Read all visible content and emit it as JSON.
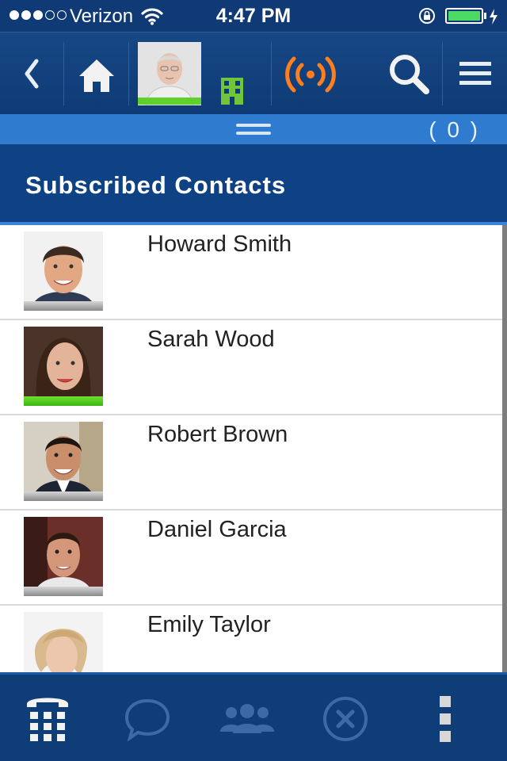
{
  "status_bar": {
    "carrier": "Verizon",
    "time": "4:47 PM",
    "signal_bars_filled": 3,
    "signal_bars_total": 5,
    "battery_level": 0.9,
    "battery_color": "#4cd964"
  },
  "toolbar": {
    "icons": [
      "back-icon",
      "home-icon",
      "avatar",
      "building-icon",
      "broadcast-icon",
      "search-icon",
      "menu-icon"
    ],
    "presence_color": "#5ed12a",
    "broadcast_color": "#ff7f1e"
  },
  "strip": {
    "count": "( 0 )"
  },
  "header": {
    "title": "Subscribed Contacts"
  },
  "contacts": [
    {
      "name": "Howard Smith",
      "status": "offline"
    },
    {
      "name": "Sarah Wood",
      "status": "online"
    },
    {
      "name": "Robert Brown",
      "status": "offline"
    },
    {
      "name": "Daniel Garcia",
      "status": "offline"
    },
    {
      "name": "Emily Taylor",
      "status": "offline"
    }
  ],
  "bottom_bar": {
    "icons": [
      "dialpad-icon",
      "chat-icon",
      "contacts-icon",
      "cancel-icon",
      "more-icon"
    ]
  },
  "colors": {
    "navy": "#0f3a75",
    "strip_blue": "#2f7bcf",
    "header_blue": "#0e4285",
    "online": "#5ed12a"
  }
}
